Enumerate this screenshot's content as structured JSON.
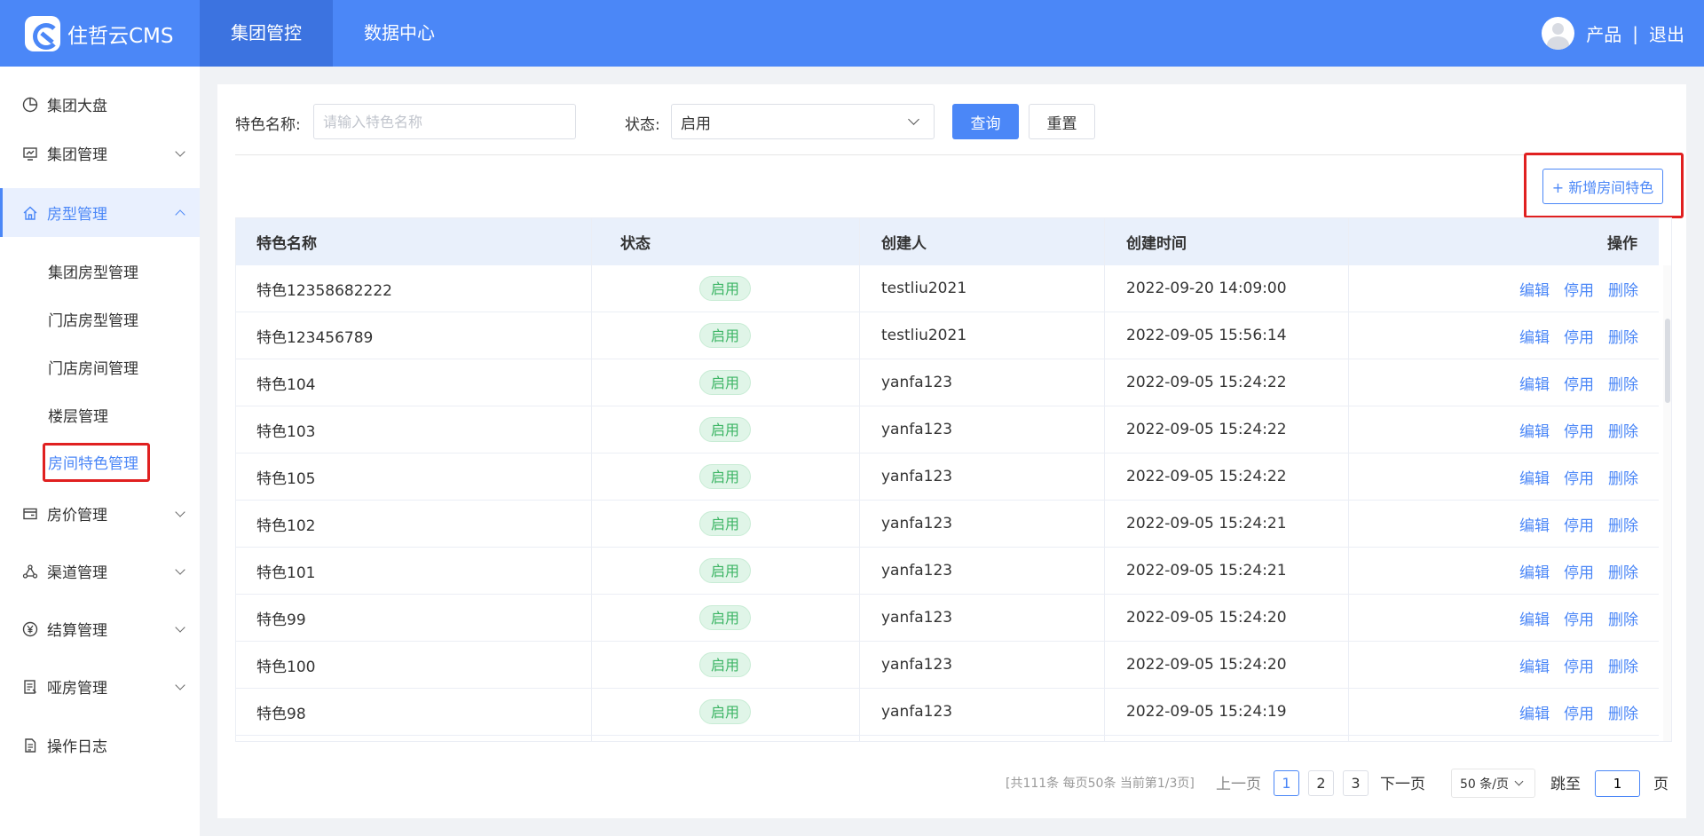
{
  "header": {
    "logo_text": "住哲云CMS",
    "nav": [
      {
        "label": "集团管控",
        "active": true
      },
      {
        "label": "数据中心",
        "active": false
      }
    ],
    "user_name": "产品",
    "separator": "|",
    "logout": "退出",
    "accent_color": "#4b87f7"
  },
  "sidebar": {
    "items": [
      {
        "label": "集团大盘",
        "icon": "pie-chart-icon"
      },
      {
        "label": "集团管理",
        "icon": "monitor-chart-icon"
      },
      {
        "label": "房型管理",
        "icon": "home-icon"
      },
      {
        "label": "房价管理",
        "icon": "wallet-icon"
      },
      {
        "label": "渠道管理",
        "icon": "network-icon"
      },
      {
        "label": "结算管理",
        "icon": "yen-circle-icon"
      },
      {
        "label": "哑房管理",
        "icon": "document-list-icon"
      },
      {
        "label": "操作日志",
        "icon": "log-file-icon"
      }
    ],
    "sub_items": [
      {
        "label": "集团房型管理"
      },
      {
        "label": "门店房型管理"
      },
      {
        "label": "门店房间管理"
      },
      {
        "label": "楼层管理"
      },
      {
        "label": "房间特色管理",
        "active": true
      }
    ]
  },
  "filter": {
    "name_label": "特色名称:",
    "name_placeholder": "请输入特色名称",
    "name_value": "",
    "status_label": "状态:",
    "status_value": "启用",
    "query_button": "查询",
    "reset_button": "重置",
    "add_button": "+ 新增房间特色"
  },
  "table": {
    "columns": [
      "特色名称",
      "状态",
      "创建人",
      "创建时间",
      "操作"
    ],
    "actions": [
      "编辑",
      "停用",
      "删除"
    ],
    "rows": [
      {
        "name": "特色12358682222",
        "status": "启用",
        "creator": "testliu2021",
        "created": "2022-09-20 14:09:00"
      },
      {
        "name": "特色123456789",
        "status": "启用",
        "creator": "testliu2021",
        "created": "2022-09-05 15:56:14"
      },
      {
        "name": "特色104",
        "status": "启用",
        "creator": "yanfa123",
        "created": "2022-09-05 15:24:22"
      },
      {
        "name": "特色103",
        "status": "启用",
        "creator": "yanfa123",
        "created": "2022-09-05 15:24:22"
      },
      {
        "name": "特色105",
        "status": "启用",
        "creator": "yanfa123",
        "created": "2022-09-05 15:24:22"
      },
      {
        "name": "特色102",
        "status": "启用",
        "creator": "yanfa123",
        "created": "2022-09-05 15:24:21"
      },
      {
        "name": "特色101",
        "status": "启用",
        "creator": "yanfa123",
        "created": "2022-09-05 15:24:21"
      },
      {
        "name": "特色99",
        "status": "启用",
        "creator": "yanfa123",
        "created": "2022-09-05 15:24:20"
      },
      {
        "name": "特色100",
        "status": "启用",
        "creator": "yanfa123",
        "created": "2022-09-05 15:24:20"
      },
      {
        "name": "特色98",
        "status": "启用",
        "creator": "yanfa123",
        "created": "2022-09-05 15:24:19"
      }
    ]
  },
  "pagination": {
    "summary": "[共111条 每页50条 当前第1/3页]",
    "prev": "上一页",
    "pages": [
      "1",
      "2",
      "3"
    ],
    "current_page": "1",
    "next": "下一页",
    "page_size": "50 条/页",
    "jump_label": "跳至",
    "jump_value": "1",
    "page_unit": "页"
  }
}
